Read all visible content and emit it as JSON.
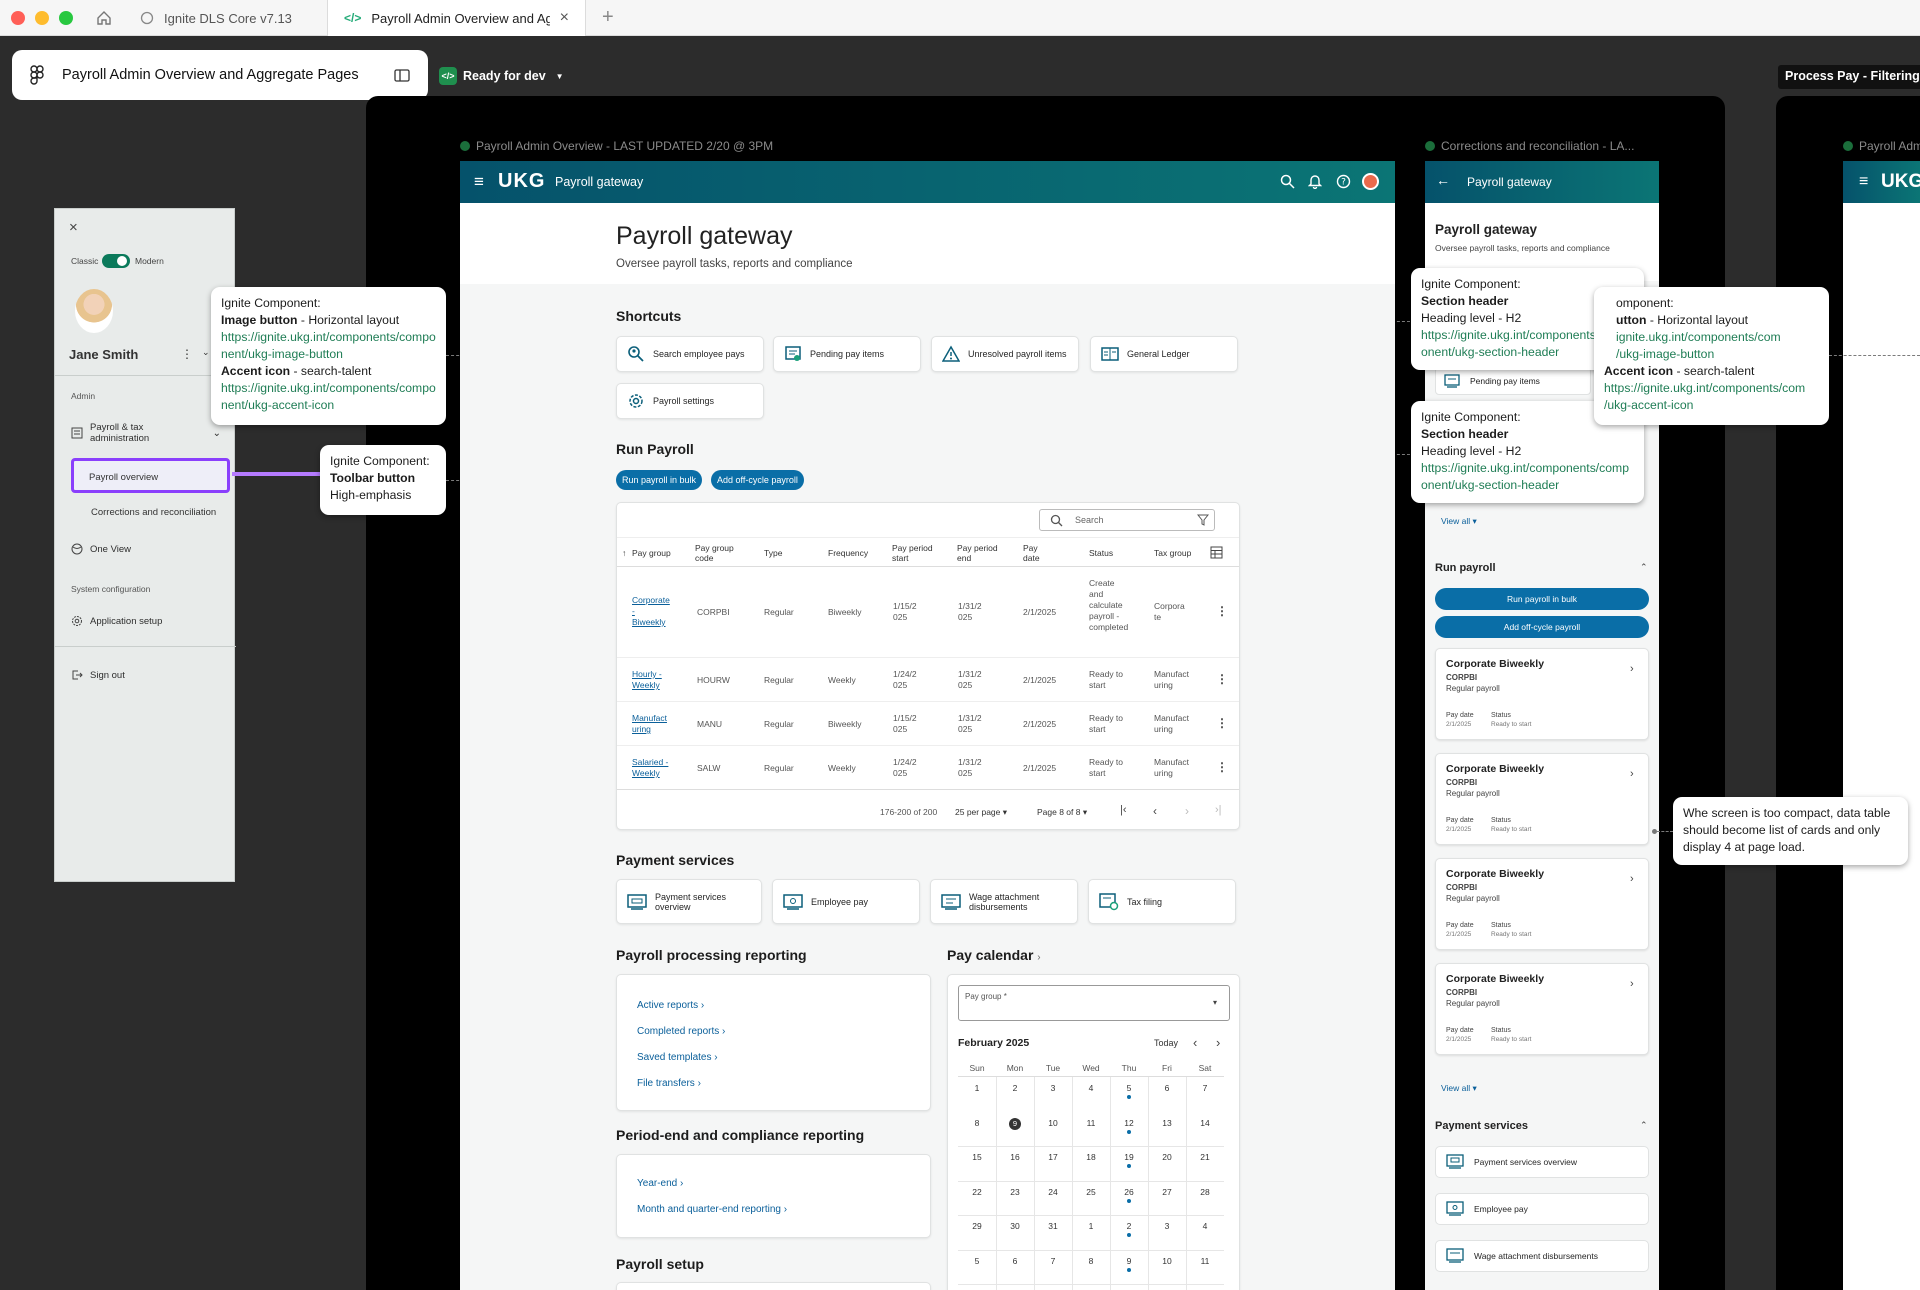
{
  "browser": {
    "tabs": [
      {
        "label": "Ignite DLS Core v7.13"
      },
      {
        "label": "Payroll Admin Overview and Aggr"
      }
    ]
  },
  "figma": {
    "file_title": "Payroll Admin Overview and Aggregate Pages",
    "status": "Ready for dev",
    "right_frame_tag": "Process Pay - Filtering p",
    "frames": {
      "main": "Payroll Admin Overview - LAST UPDATED 2/20 @ 3PM",
      "mobile": "Corrections and reconciliation - LA...",
      "third": "Payroll Adm"
    }
  },
  "sidenav": {
    "toggle_left": "Classic",
    "toggle_right": "Modern",
    "user_name": "Jane Smith",
    "section_admin": "Admin",
    "item_payroll_tax": "Payroll & tax administration",
    "item_overview": "Payroll overview",
    "item_corrections": "Corrections and reconciliation",
    "item_oneview": "One View",
    "section_system": "System configuration",
    "item_app_setup": "Application setup",
    "item_signout": "Sign out"
  },
  "callouts": {
    "image_button": {
      "line1": "Ignite Component:",
      "bold1": "Image button",
      "rest1": " - Horizontal layout",
      "link1": "https://ignite.ukg.int/components/component/ukg-image-button",
      "bold2": "Accent icon",
      "rest2": " - search-talent",
      "link2": "https://ignite.ukg.int/components/component/ukg-accent-icon"
    },
    "toolbar_button": {
      "line1": "Ignite Component:",
      "bold": "Toolbar button",
      "line3": "High-emphasis"
    },
    "section_header_1": {
      "line1": "Ignite Component:",
      "bold": "Section header",
      "line3": "Heading level - H2",
      "link": "https://ignite.ukg.int/components/component/ukg-section-header"
    },
    "section_header_2": {
      "line1": "Ignite Component:",
      "bold": "Section header",
      "line3": "Heading level - H2",
      "link": "https://ignite.ukg.int/components/component/ukg-section-header"
    },
    "right_partial": {
      "line1": "omponent:",
      "bold1": "utton",
      "rest1": " - Horizontal layout",
      "link1a": "ignite.ukg.int/components/com",
      "link1b": "/ukg-image-button",
      "bold2": "Accent icon",
      "rest2": " - search-talent",
      "link2a": "https://ignite.ukg.int/components/com",
      "link2b": "/ukg-accent-icon"
    },
    "compact_note": "Whe screen is too compact, data table should become list of cards and only display 4 at page load."
  },
  "app": {
    "brand": "UKG",
    "topbar_title": "Payroll gateway",
    "page_title": "Payroll gateway",
    "page_subtitle": "Oversee payroll tasks, reports and compliance",
    "shortcuts_title": "Shortcuts",
    "shortcuts": [
      {
        "label": "Search employee pays",
        "icon": "search-talent-icon"
      },
      {
        "label": "Pending pay items",
        "icon": "pending-items-icon"
      },
      {
        "label": "Unresolved payroll items",
        "icon": "warning-icon"
      },
      {
        "label": "General Ledger",
        "icon": "ledger-icon"
      },
      {
        "label": "Payroll settings",
        "icon": "settings-icon"
      }
    ],
    "run_payroll_title": "Run Payroll",
    "run_bulk": "Run payroll in bulk",
    "add_offcycle": "Add off-cycle payroll",
    "search_placeholder": "Search",
    "table": {
      "headers": [
        "Pay group",
        "Pay group code",
        "Type",
        "Frequency",
        "Pay period start",
        "Pay period end",
        "Pay date",
        "Status",
        "Tax group"
      ],
      "rows": [
        [
          "Corporate - Biweekly",
          "CORPBI",
          "Regular",
          "Biweekly",
          "1/15/2025",
          "1/31/2025",
          "2/1/2025",
          "Create and calculate payroll - completed",
          "Corporate"
        ],
        [
          "Hourly - Weekly",
          "HOURW",
          "Regular",
          "Weekly",
          "1/24/2025",
          "1/31/2025",
          "2/1/2025",
          "Ready to start",
          "Manufacturing"
        ],
        [
          "Manufacturing",
          "MANU",
          "Regular",
          "Biweekly",
          "1/15/2025",
          "1/31/2025",
          "2/1/2025",
          "Ready to start",
          "Manufacturing"
        ],
        [
          "Salaried - Weekly",
          "SALW",
          "Regular",
          "Weekly",
          "1/24/2025",
          "1/31/2025",
          "2/1/2025",
          "Ready to start",
          "Manufacturing"
        ]
      ],
      "range": "176-200 of 200",
      "per_page": "25 per page",
      "page": "Page 8 of 8"
    },
    "payment_title": "Payment services",
    "payment_items": [
      {
        "label": "Payment services overview"
      },
      {
        "label": "Employee pay"
      },
      {
        "label": "Wage attachment disbursements"
      },
      {
        "label": "Tax filing"
      }
    ],
    "ppr_title": "Payroll processing reporting",
    "ppr_links": [
      "Active reports",
      "Completed reports",
      "Saved templates",
      "File transfers"
    ],
    "pec_title": "Period-end and compliance reporting",
    "pec_links": [
      "Year-end",
      "Month and quarter-end reporting"
    ],
    "setup_title": "Payroll setup",
    "calendar": {
      "title": "Pay calendar",
      "select_label": "Pay group *",
      "month": "February 2025",
      "today": "Today",
      "weekdays": [
        "Sun",
        "Mon",
        "Tue",
        "Wed",
        "Thu",
        "Fri",
        "Sat"
      ],
      "weeks": [
        [
          "",
          "",
          "",
          "",
          "",
          "",
          ""
        ],
        [
          "1",
          "2",
          "3",
          "4",
          "5",
          "6",
          "7"
        ],
        [
          "8",
          "9",
          "10",
          "11",
          "12",
          "13",
          "14"
        ],
        [
          "15",
          "16",
          "17",
          "18",
          "19",
          "20",
          "21"
        ],
        [
          "22",
          "23",
          "24",
          "25",
          "26",
          "27",
          "28"
        ],
        [
          "29",
          "30",
          "31",
          "1",
          "2",
          "3",
          "4"
        ],
        [
          "5",
          "6",
          "7",
          "8",
          "9",
          "10",
          "11"
        ]
      ]
    }
  },
  "mobile": {
    "topbar_title": "Payroll gateway",
    "page_title": "Payroll gateway",
    "page_subtitle": "Oversee payroll tasks, reports and compliance",
    "pending": "Pending pay items",
    "view_all": "View all",
    "run_title": "Run payroll",
    "run_bulk": "Run payroll in bulk",
    "add_offcycle": "Add off-cycle payroll",
    "card_title": "Corporate Biweekly",
    "card_code": "CORPBI",
    "card_type": "Regular payroll",
    "card_pay_date_label": "Pay date",
    "card_pay_date": "2/1/2025",
    "card_status_label": "Status",
    "card_status": "Ready to start",
    "payment_title": "Payment services",
    "payment_items": [
      "Payment services overview",
      "Employee pay",
      "Wage attachment disbursements"
    ]
  },
  "colors": {
    "accent_teal": "#0b7575",
    "primary_blue": "#0a6ea7",
    "selection_purple": "#8a3ffc"
  }
}
